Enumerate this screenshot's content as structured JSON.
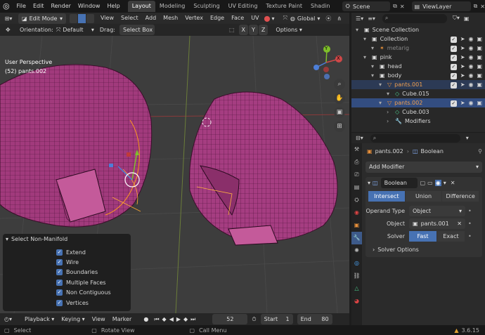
{
  "topbar": {
    "menus": [
      "File",
      "Edit",
      "Render",
      "Window",
      "Help"
    ],
    "workspaces": [
      "Layout",
      "Modeling",
      "Sculpting",
      "UV Editing",
      "Texture Paint",
      "Shadin"
    ],
    "active_workspace": "Layout",
    "scene_name": "Scene",
    "view_layer_name": "ViewLayer"
  },
  "viewport_header": {
    "mode": "Edit Mode",
    "menus": [
      "View",
      "Select",
      "Add",
      "Mesh",
      "Vertex",
      "Edge",
      "Face",
      "UV"
    ],
    "transform_orientation": "Global"
  },
  "tool_header": {
    "orientation_label": "Orientation:",
    "orientation_value": "Default",
    "drag_label": "Drag:",
    "drag_value": "Select Box",
    "axes": [
      "X",
      "Y",
      "Z"
    ],
    "options_label": "Options"
  },
  "viewport": {
    "view_name": "User Perspective",
    "object_info": "(52) pants.002",
    "gizmo_axes": [
      "Y",
      "X"
    ]
  },
  "operator_panel": {
    "title": "Select Non-Manifold",
    "options": [
      {
        "label": "Extend",
        "checked": true
      },
      {
        "label": "Wire",
        "checked": true
      },
      {
        "label": "Boundaries",
        "checked": true
      },
      {
        "label": "Multiple Faces",
        "checked": true
      },
      {
        "label": "Non Contiguous",
        "checked": true
      },
      {
        "label": "Vertices",
        "checked": true
      }
    ]
  },
  "timeline": {
    "menus": [
      "Playback",
      "Keying",
      "View",
      "Marker"
    ],
    "current_frame": "52",
    "start_label": "Start",
    "start_value": "1",
    "end_label": "End",
    "end_value": "80"
  },
  "statusbar": {
    "hints": [
      "Select",
      "Rotate View",
      "Call Menu"
    ],
    "version": "3.6.15"
  },
  "outliner": {
    "rows": [
      {
        "label": "Scene Collection",
        "indent": 0,
        "icon": "collection-icon",
        "selected": false,
        "active": false,
        "visible_controls": false
      },
      {
        "label": "Collection",
        "indent": 1,
        "icon": "collection-icon",
        "selected": false,
        "active": false,
        "visible_controls": true
      },
      {
        "label": "metarig",
        "indent": 2,
        "icon": "armature-icon",
        "selected": false,
        "active": false,
        "visible_controls": true,
        "dim": true
      },
      {
        "label": "pink",
        "indent": 1,
        "icon": "collection-icon",
        "selected": false,
        "active": false,
        "visible_controls": true
      },
      {
        "label": "head",
        "indent": 2,
        "icon": "collection-icon",
        "selected": false,
        "active": false,
        "visible_controls": true
      },
      {
        "label": "body",
        "indent": 2,
        "icon": "collection-icon",
        "selected": false,
        "active": false,
        "visible_controls": true
      },
      {
        "label": "pants.001",
        "indent": 3,
        "icon": "mesh-icon",
        "selected": true,
        "active": false,
        "visible_controls": true,
        "orange": true
      },
      {
        "label": "Cube.015",
        "indent": 4,
        "icon": "mesh-data-icon",
        "selected": false,
        "active": false,
        "visible_controls": false
      },
      {
        "label": "pants.002",
        "indent": 3,
        "icon": "mesh-icon",
        "selected": true,
        "active": true,
        "visible_controls": true,
        "orange": true
      },
      {
        "label": "Cube.003",
        "indent": 4,
        "icon": "mesh-data-icon",
        "selected": false,
        "active": false,
        "visible_controls": false
      },
      {
        "label": "Modifiers",
        "indent": 4,
        "icon": "wrench-icon",
        "selected": false,
        "active": false,
        "visible_controls": false
      }
    ]
  },
  "properties": {
    "breadcrumb_object": "pants.002",
    "breadcrumb_modifier": "Boolean",
    "add_modifier_label": "Add Modifier",
    "modifier_name": "Boolean",
    "operations": [
      "Intersect",
      "Union",
      "Difference"
    ],
    "active_operation": "Intersect",
    "operand_type_label": "Operand Type",
    "operand_type_value": "Object",
    "object_label": "Object",
    "object_value": "pants.001",
    "solver_label": "Solver",
    "solvers": [
      "Fast",
      "Exact"
    ],
    "active_solver": "Fast",
    "solver_options_label": "Solver Options"
  },
  "colors": {
    "accent": "#4772b3",
    "mesh": "#a13a7c",
    "selection": "#ff9a1e",
    "viewport_bg": "#3d3d3d"
  }
}
